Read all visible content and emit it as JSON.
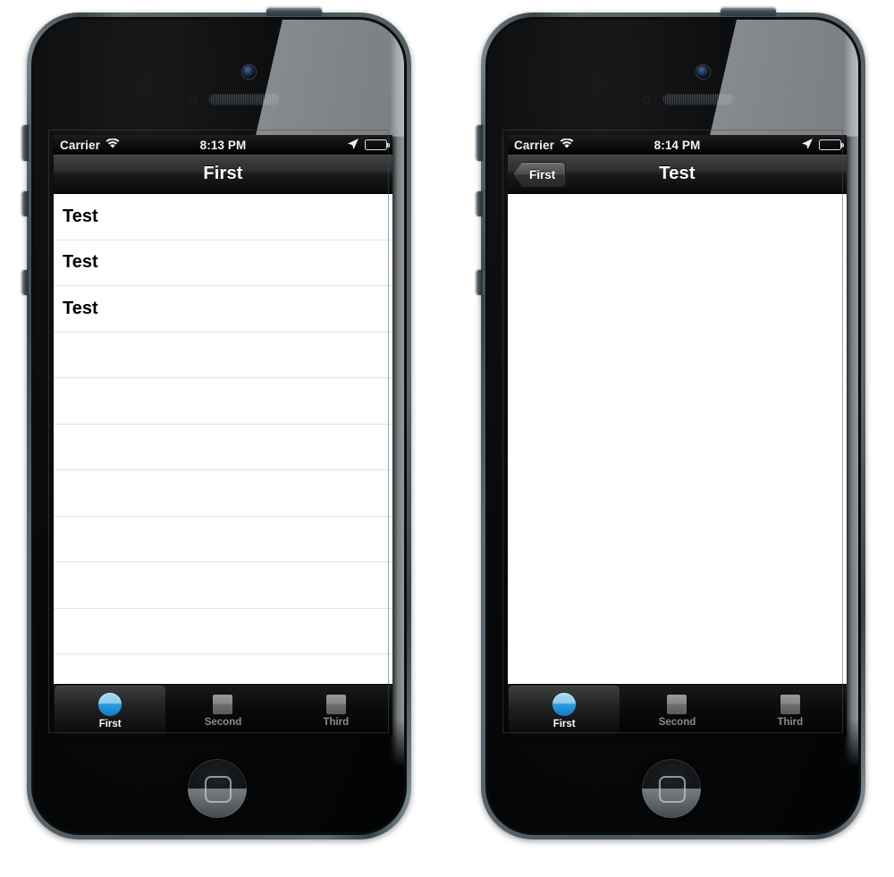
{
  "phones": [
    {
      "id": "phone-left",
      "status_bar": {
        "carrier": "Carrier",
        "time": "8:13 PM",
        "wifi_icon": "wifi-icon",
        "location_icon": "location-arrow-icon",
        "battery_icon": "battery-icon"
      },
      "nav_bar": {
        "title": "First",
        "has_back_button": false,
        "back_label": ""
      },
      "content": {
        "type": "table",
        "cells": [
          "Test",
          "Test",
          "Test"
        ],
        "empty_rows": 8
      },
      "tab_bar": {
        "selected_index": 0,
        "tabs": [
          {
            "label": "First",
            "icon": "blue-circle-icon"
          },
          {
            "label": "Second",
            "icon": "gray-square-icon"
          },
          {
            "label": "Third",
            "icon": "gray-square-icon"
          }
        ]
      }
    },
    {
      "id": "phone-right",
      "status_bar": {
        "carrier": "Carrier",
        "time": "8:14 PM",
        "wifi_icon": "wifi-icon",
        "location_icon": "location-arrow-icon",
        "battery_icon": "battery-icon"
      },
      "nav_bar": {
        "title": "Test",
        "has_back_button": true,
        "back_label": "First"
      },
      "content": {
        "type": "blank",
        "cells": [],
        "empty_rows": 0
      },
      "tab_bar": {
        "selected_index": 0,
        "tabs": [
          {
            "label": "First",
            "icon": "blue-circle-icon"
          },
          {
            "label": "Second",
            "icon": "gray-square-icon"
          },
          {
            "label": "Third",
            "icon": "gray-square-icon"
          }
        ]
      }
    }
  ],
  "colors": {
    "accent_blue": "#2b9fe0",
    "nav_bar_top": "#5b5b5b",
    "nav_bar_bottom": "#070707",
    "cell_separator": "#e2e2e2",
    "tab_label_inactive": "#8c8c8c",
    "tab_label_active": "#ffffff",
    "screen_background": "#ffffff",
    "device_body": "#0a0c0d"
  }
}
